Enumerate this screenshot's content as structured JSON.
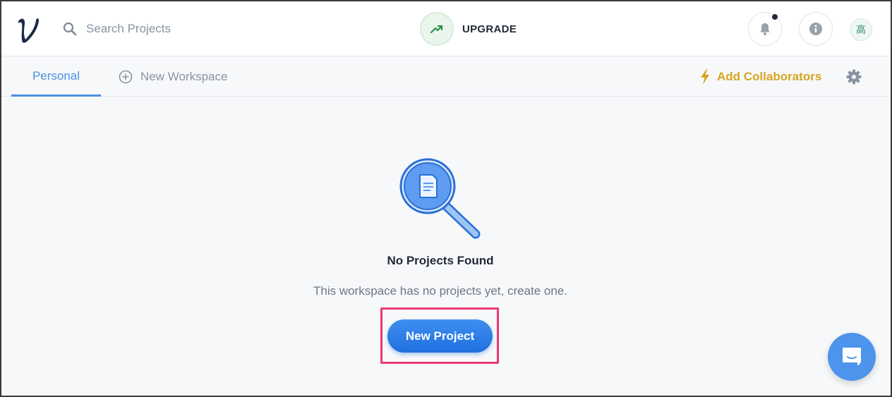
{
  "header": {
    "search_placeholder": "Search Projects",
    "upgrade_label": "UPGRADE",
    "avatar_initial": "高"
  },
  "subnav": {
    "tab_personal": "Personal",
    "tab_new_workspace": "New Workspace",
    "add_collaborators": "Add Collaborators"
  },
  "empty_state": {
    "title": "No Projects Found",
    "subtitle": "This workspace has no projects yet, create one.",
    "button_label": "New Project"
  },
  "colors": {
    "accent_blue": "#4a90e2",
    "button_blue": "#1f6fe0",
    "collab_gold": "#d5a621",
    "highlight_pink": "#ea3a73",
    "upgrade_green": "#2f8f4e"
  },
  "icons": [
    "brand-logo-icon",
    "search-icon",
    "trending-up-icon",
    "bell-icon",
    "info-icon",
    "plus-circle-icon",
    "lightning-bolt-icon",
    "gear-icon",
    "magnifier-document-icon",
    "chat-icon"
  ]
}
